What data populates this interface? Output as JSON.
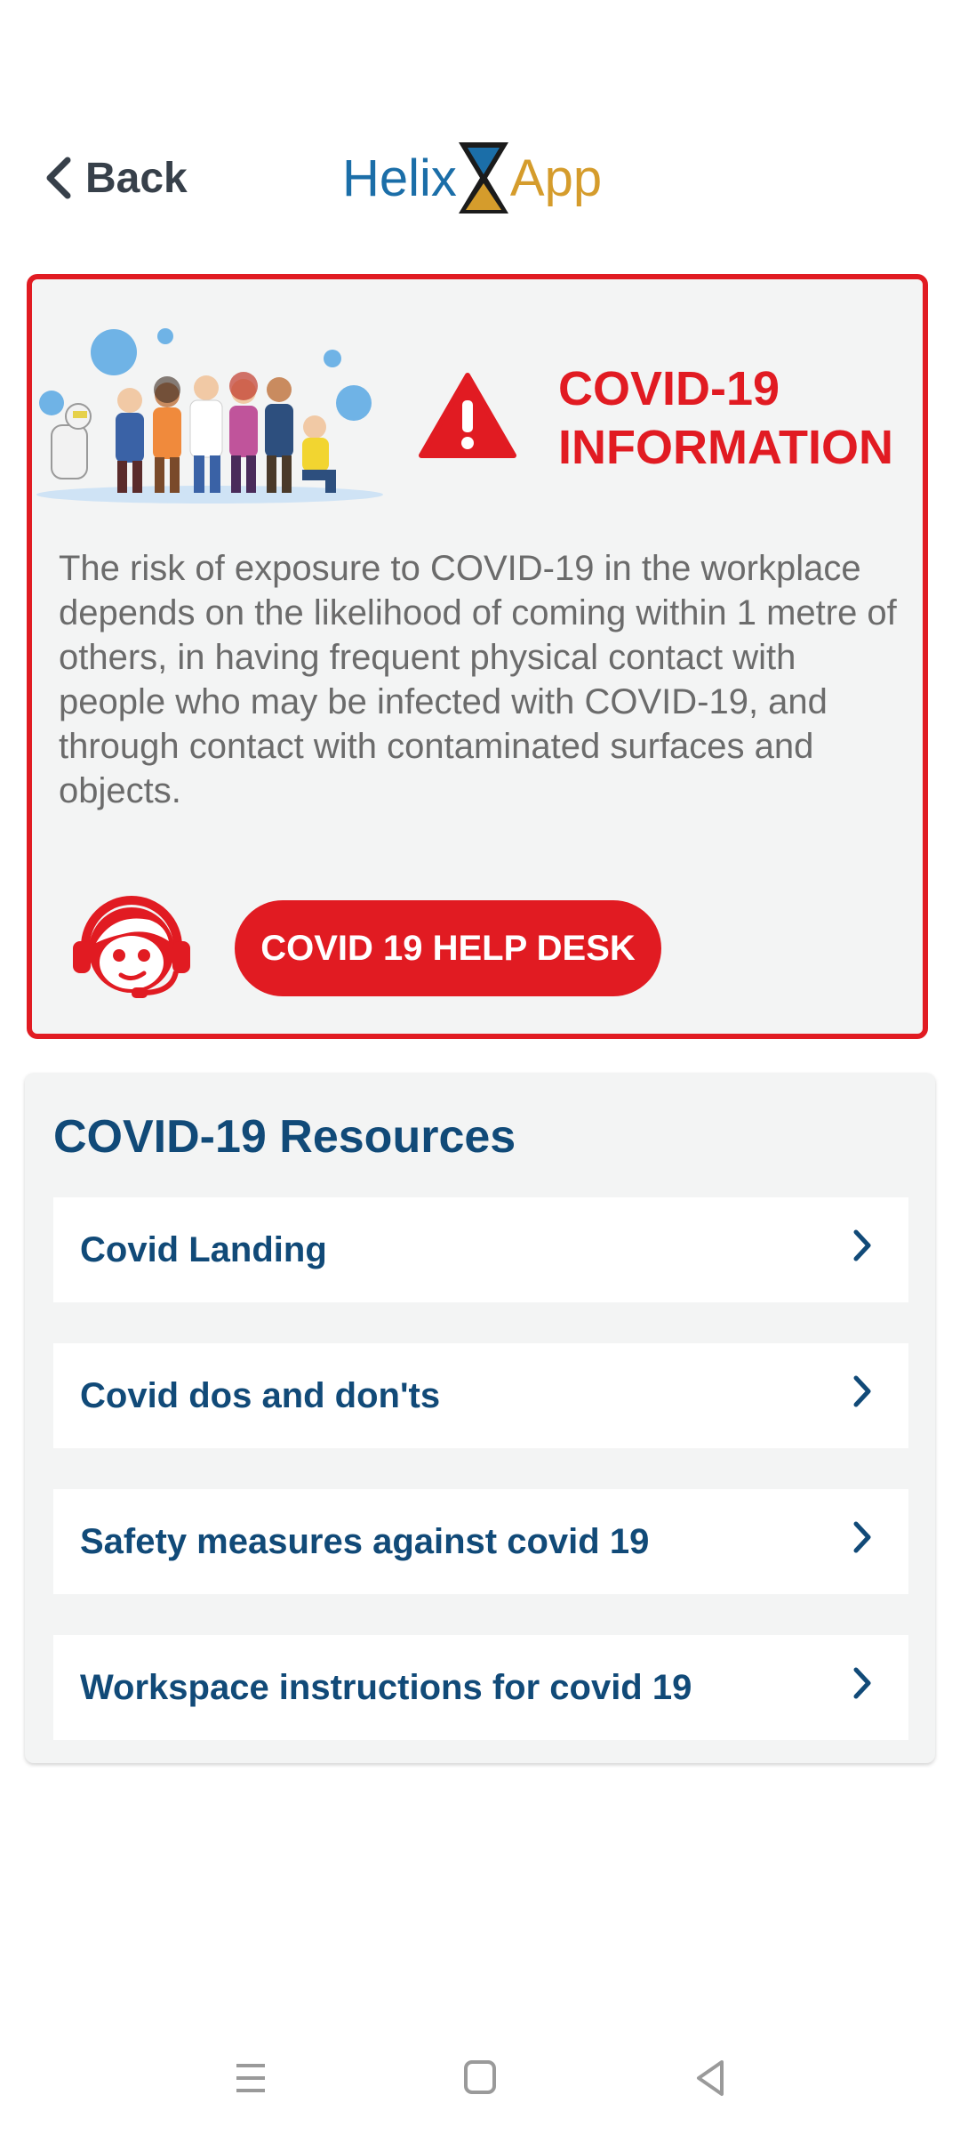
{
  "header": {
    "back_label": "Back",
    "logo_left": "Helix",
    "logo_right": "App"
  },
  "info_card": {
    "title_line1": "COVID-19",
    "title_line2": "INFORMATION",
    "body": "The risk of exposure to COVID-19 in the workplace depends on the likelihood of coming within 1 metre of others, in having frequent physical contact with people who may be infected with COVID-19, and through contact with contaminated surfaces and objects.",
    "helpdesk_label": "COVID 19 HELP DESK",
    "accent_color": "#e11b22"
  },
  "resources": {
    "title": "COVID-19 Resources",
    "items": [
      {
        "label": "Covid Landing"
      },
      {
        "label": "Covid dos and don'ts"
      },
      {
        "label": "Safety measures against covid 19"
      },
      {
        "label": "Workspace instructions for covid 19"
      }
    ],
    "text_color": "#114a78"
  },
  "icons": [
    "chevron-left-icon",
    "hourglass-logo-icon",
    "warning-icon",
    "crowd-illustration",
    "support-agent-icon",
    "chevron-right-icon",
    "menu-icon",
    "home-icon",
    "back-triangle-icon"
  ]
}
